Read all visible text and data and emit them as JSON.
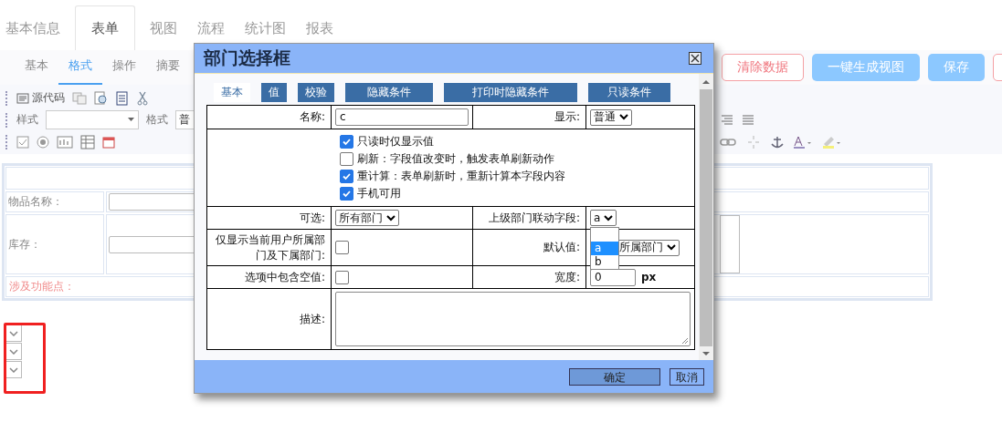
{
  "top_tabs": [
    {
      "label": "基本信息",
      "selected": false
    },
    {
      "label": "表单",
      "selected": true
    },
    {
      "label": "视图",
      "selected": false
    },
    {
      "label": "流程",
      "selected": false
    },
    {
      "label": "统计图",
      "selected": false
    },
    {
      "label": "报表",
      "selected": false
    }
  ],
  "sub_tabs": [
    {
      "label": "基本",
      "selected": false
    },
    {
      "label": "格式",
      "selected": true
    },
    {
      "label": "操作",
      "selected": false
    },
    {
      "label": "摘要",
      "selected": false
    }
  ],
  "actions": [
    {
      "label": "清除数据",
      "kind": "danger"
    },
    {
      "label": "一键生成视图",
      "kind": "primary"
    },
    {
      "label": "保存",
      "kind": "primary"
    },
    {
      "kind": "danger"
    }
  ],
  "toolbar": {
    "source_label": "源代码",
    "style_label": "样式",
    "format_label": "格式",
    "format_value": "普"
  },
  "form": {
    "rows": [
      {
        "kind": "blank"
      },
      {
        "kind": "input",
        "label": "物品名称："
      },
      {
        "kind": "textarea",
        "label": "库存："
      },
      {
        "kind": "note",
        "label": "涉及功能点："
      }
    ]
  },
  "mini_selects": [
    {
      "kind": "select"
    },
    {
      "kind": "select"
    },
    {
      "kind": "select"
    }
  ],
  "dialog": {
    "title": "部门选择框",
    "tabs": [
      {
        "label": "基本",
        "selected": true
      },
      {
        "label": "值",
        "selected": false
      },
      {
        "label": "校验",
        "selected": false
      },
      {
        "label": "隐藏条件",
        "selected": false
      },
      {
        "label": "打印时隐藏条件",
        "selected": false
      },
      {
        "label": "只读条件",
        "selected": false
      }
    ],
    "name_label": "名称:",
    "name_value": "c",
    "display_label": "显示:",
    "display_value": "普通",
    "options": [
      {
        "label": "只读时仅显示值",
        "checked": true
      },
      {
        "label": "刷新：字段值改变时，触发表单刷新动作",
        "checked": false
      },
      {
        "label": "重计算：表单刷新时，重新计算本字段内容",
        "checked": true
      },
      {
        "label": "手机可用",
        "checked": true
      }
    ],
    "optional_label": "可选:",
    "optional_value": "所有部门",
    "parent_label": "上级部门联动字段:",
    "parent_value": "a",
    "parent_menu": [
      {
        "label": "a",
        "selected": true
      },
      {
        "label": "b",
        "selected": false
      }
    ],
    "own_dept_label": "仅显示当前用户所属部门及下属部门:",
    "own_dept_checked": false,
    "default_label": "默认值:",
    "default_value": "所属部门",
    "empty_label": "选项中包含空值:",
    "empty_checked": false,
    "width_label": "宽度:",
    "width_value": "0",
    "width_unit": "px",
    "desc_label": "描述:",
    "buttons": [
      {
        "label": "确定",
        "kind": "primary"
      },
      {
        "label": "取消",
        "kind": "secondary"
      }
    ]
  }
}
